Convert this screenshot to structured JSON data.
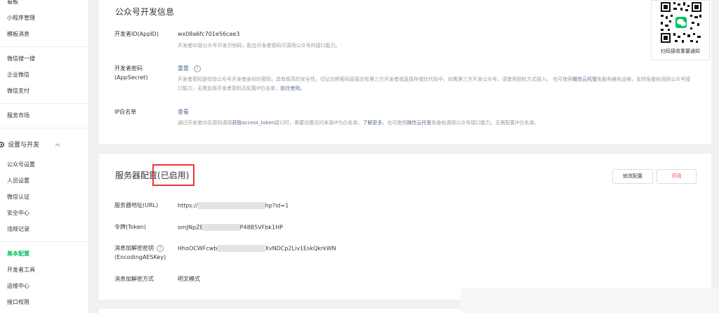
{
  "sidebar": {
    "items_top": [
      {
        "label": "看板"
      },
      {
        "label": "小程序管理"
      },
      {
        "label": "模板消息"
      },
      {
        "label": "微信搜一搜"
      },
      {
        "label": "企业微信"
      },
      {
        "label": "微信支付"
      },
      {
        "label": "服务市场"
      }
    ],
    "group": {
      "label": "设置与开发",
      "icon": "gear-icon"
    },
    "items_bottom": [
      {
        "label": "公众号设置"
      },
      {
        "label": "人员设置"
      },
      {
        "label": "微信认证"
      },
      {
        "label": "安全中心"
      },
      {
        "label": "违规记录"
      },
      {
        "label": "基本配置",
        "active": true
      },
      {
        "label": "开发者工具"
      },
      {
        "label": "运维中心"
      },
      {
        "label": "接口权限"
      }
    ]
  },
  "dev_info": {
    "title": "公众号开发信息",
    "appid_label": "开发者ID(AppID)",
    "appid_value": "wx08a6fc701e56cae3",
    "appid_desc": "开发者ID是公众号开发识别码，配合开发者密码可调用公众号的接口能力。",
    "secret_label": "开发者密码(AppSecret)",
    "secret_action": "重置",
    "secret_desc_1": "开发者密码是校验公众号开发者身份的密码，具有极高的安全性。切记勿把密码直接交给第三方开发者或直接存储在代码中。如需第三方开发公众号，请使用授权方式接入。 也可使用",
    "secret_desc_link": "微信云托管",
    "secret_desc_2": "免服务器免运维，支持免鉴权调用公众号接口能力，无需启用开发者密码及配置IP白名单，",
    "secret_desc_link2": "前往使用。",
    "ip_label": "IP白名单",
    "ip_action": "查看",
    "ip_desc_1": "通过开发者ID及密码调用",
    "ip_desc_link1": "获取access_token",
    "ip_desc_2": "接口时，需要设置访问来源IP为白名单。",
    "ip_desc_link2": "了解更多",
    "ip_desc_3": "。也可使用",
    "ip_desc_link3": "微信云托管",
    "ip_desc_4": "免鉴权调用公众号接口能力，无需配置IP白名单。"
  },
  "server_config": {
    "title": "服务器配置",
    "status": "(已启用)",
    "modify_button": "修改配置",
    "disable_button": "停用",
    "url_label": "服务器地址(URL)",
    "url_prefix": "https://",
    "url_suffix": "hp?id=1",
    "token_label": "令牌(Token)",
    "token_prefix": "omJNpZE",
    "token_suffix": "P48B5VFbk1HP",
    "aeskey_label_1": "消息加解密密钥",
    "aeskey_label_2": "(EncodingAESKey)",
    "aeskey_prefix": "HhoOCWFcwb",
    "aeskey_suffix": "XvNDCp2Liv1EskQkrkWN",
    "mode_label": "消息加解密方式",
    "mode_value": "明文模式"
  },
  "qr": {
    "caption": "扫码接收重要通知"
  },
  "colors": {
    "accent": "#07c160",
    "link": "#576b95",
    "danger": "#fa5151",
    "highlight": "#e53935"
  }
}
